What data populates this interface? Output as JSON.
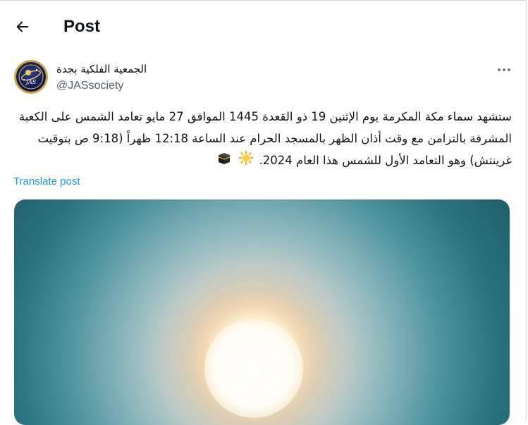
{
  "header": {
    "title": "Post"
  },
  "author": {
    "display_name": "الجمعية الفلكية بجدة",
    "handle": "@JASsociety",
    "avatar_text": "JAS"
  },
  "post": {
    "text": "ستشهد سماء مكة المكرمة يوم الإثنين 19 ذو القعدة 1445 الموافق 27 مايو تعامد الشمس على الكعبة المشرفة بالتزامن مع وقت أذان الظهر بالمسجد الحرام عند الساعة 12:18 ظهراً (9:18 ص بتوقيت غرينتش) وهو التعامد الأول للشمس هذا العام 2024.",
    "emojis": [
      "kaaba-icon",
      "sun-icon"
    ],
    "translate_label": "Translate post"
  },
  "colors": {
    "link": "#1d9bf0",
    "secondary_text": "#536471",
    "primary_text": "#0f1419"
  }
}
